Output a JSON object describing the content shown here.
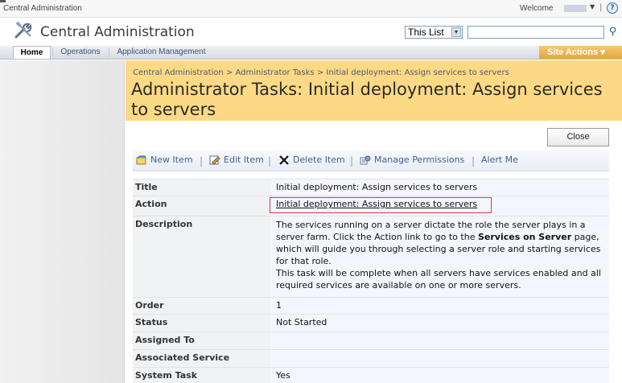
{
  "top_bar": {
    "app_name": "Central Administration",
    "welcome_text": "Welcome",
    "user_menu_arrow": "▼",
    "separator": "|",
    "help_icon": "?"
  },
  "header": {
    "site_title": "Central Administration",
    "scope_value": "This List",
    "search_placeholder": "",
    "search_icon": "⚲"
  },
  "nav": {
    "tabs": [
      {
        "label": "Home"
      },
      {
        "label": "Operations"
      },
      {
        "label": "Application Management"
      }
    ],
    "site_actions": "Site Actions ▾"
  },
  "page": {
    "breadcrumb": "Central Administration > Administrator Tasks > Initial deployment: Assign services to servers",
    "title": "Administrator Tasks: Initial deployment: Assign services to servers"
  },
  "buttons": {
    "close": "Close"
  },
  "toolbar": {
    "new_item": "New Item",
    "edit_item": "Edit Item",
    "delete_item": "Delete Item",
    "manage_permissions": "Manage Permissions",
    "alert_me": "Alert Me",
    "separator": "|"
  },
  "fields": {
    "title": {
      "label": "Title",
      "value": "Initial deployment: Assign services to servers"
    },
    "action": {
      "label": "Action",
      "value": "Initial deployment: Assign services to servers"
    },
    "description": {
      "label": "Description",
      "part1": "The services running on a server dictate the role the server plays in a server farm. Click the Action link to go to the ",
      "bold": "Services on Server",
      "part2": " page, which will guide you through selecting a server role and starting services for that role.",
      "line2": "This task will be complete when all servers have services enabled and all required services are available on one or more servers."
    },
    "order": {
      "label": "Order",
      "value": "1"
    },
    "status": {
      "label": "Status",
      "value": "Not Started"
    },
    "assigned_to": {
      "label": "Assigned To",
      "value": ""
    },
    "associated_service": {
      "label": "Associated Service",
      "value": ""
    },
    "system_task": {
      "label": "System Task",
      "value": "Yes"
    }
  },
  "colors": {
    "title_band": "#fcd985",
    "site_actions": "#e6a63c",
    "value_background": "#f3f7fd",
    "highlight_box": "#d33c3c"
  }
}
